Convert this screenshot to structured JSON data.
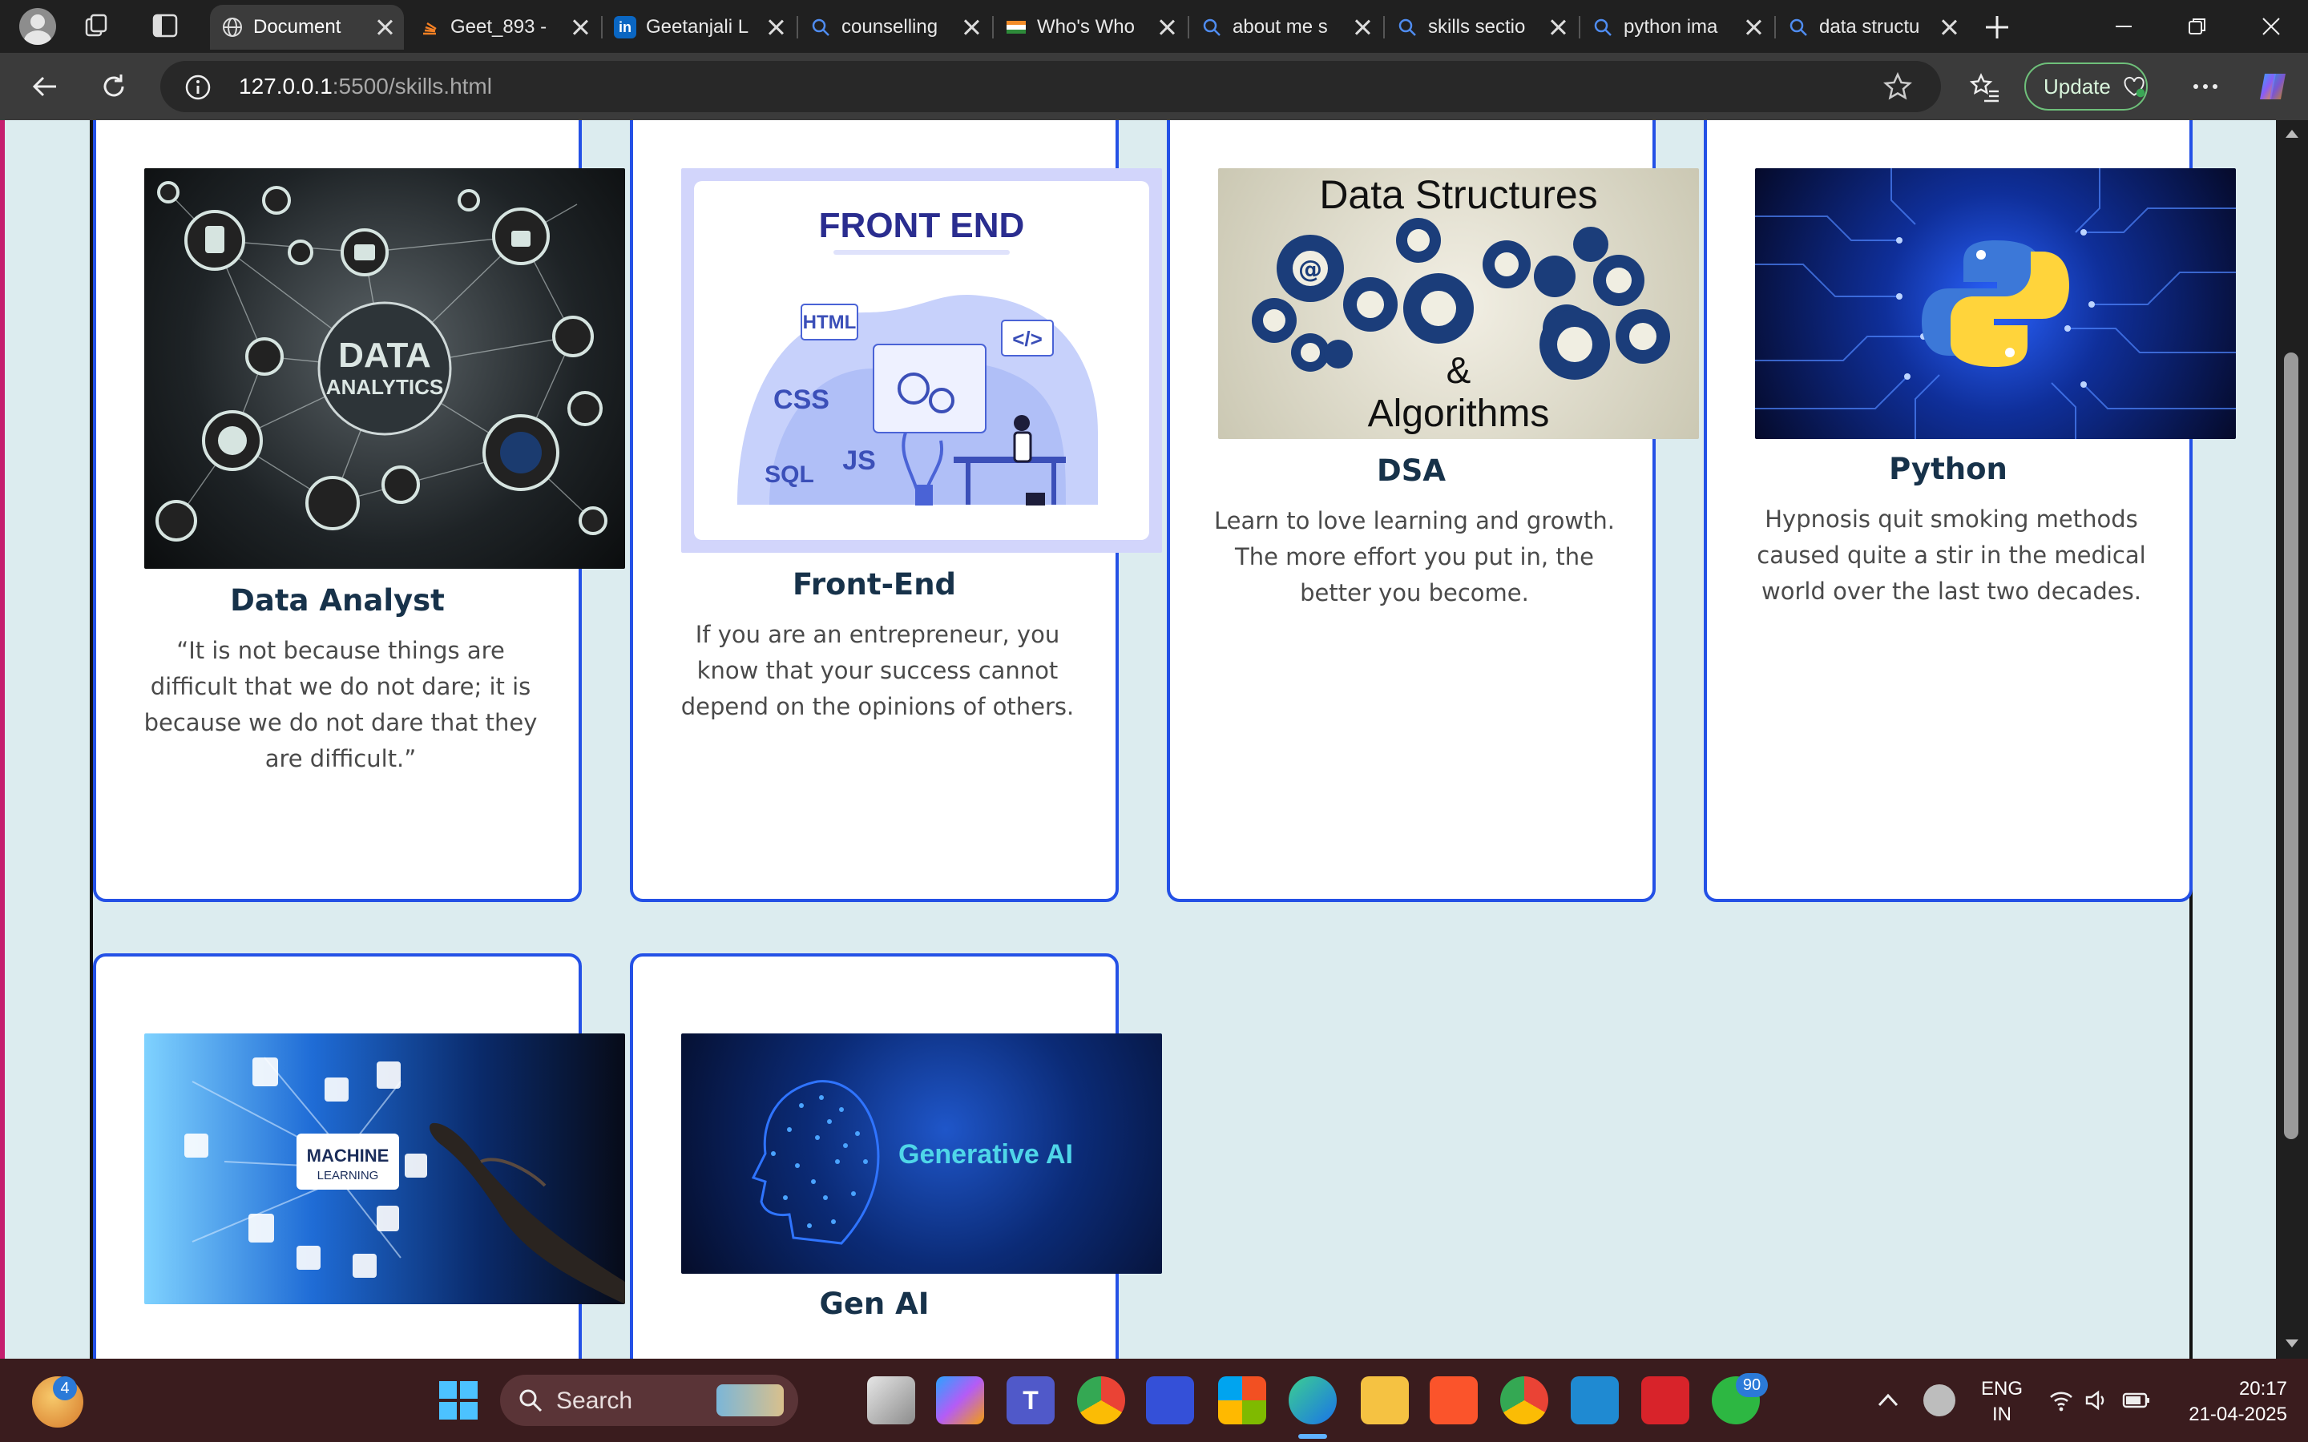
{
  "browser": {
    "tabs": [
      {
        "title": "Document",
        "active": true
      },
      {
        "title": "Geet_893 -"
      },
      {
        "title": "Geetanjali L"
      },
      {
        "title": "counselling"
      },
      {
        "title": "Who's Who"
      },
      {
        "title": "about me s"
      },
      {
        "title": "skills sectio"
      },
      {
        "title": "python ima"
      },
      {
        "title": "data structu"
      }
    ],
    "url_host": "127.0.0.1",
    "url_path": ":5500/skills.html",
    "update_label": "Update",
    "icons": [
      "back-icon",
      "refresh-icon",
      "info-icon",
      "star-icon",
      "favorites-icon",
      "more-icon",
      "copilot-icon"
    ]
  },
  "cards": [
    {
      "title": "Data Analyst",
      "desc": "“It is not because things are difficult that we do not dare; it is because we do not dare that they are difficult.”",
      "image_text": [
        "DATA",
        "ANALYTICS"
      ]
    },
    {
      "title": "Front-End",
      "desc": "If you are an entrepreneur, you know that your success cannot depend on the opinions of others.",
      "image_text": [
        "FRONT END",
        "HTML",
        "CSS",
        "JS",
        "SQL",
        "</>"
      ]
    },
    {
      "title": "DSA",
      "desc": "Learn to love learning and growth. The more effort you put in, the better you become.",
      "image_text": [
        "Data Structures",
        "&",
        "Algorithms"
      ]
    },
    {
      "title": "Python",
      "desc": "Hypnosis quit smoking methods caused quite a stir in the medical world over the last two decades.",
      "image_text": []
    },
    {
      "title": "",
      "desc": "",
      "image_text": [
        "MACHINE",
        "LEARNING"
      ]
    },
    {
      "title": "Gen AI",
      "desc": "",
      "image_text": [
        "Generative AI"
      ]
    }
  ],
  "taskbar": {
    "search_label": "Search",
    "lang_top": "ENG",
    "lang_bottom": "IN",
    "time": "20:17",
    "date": "21-04-2025",
    "whatsapp_badge": "90",
    "weather_badge": "4"
  }
}
